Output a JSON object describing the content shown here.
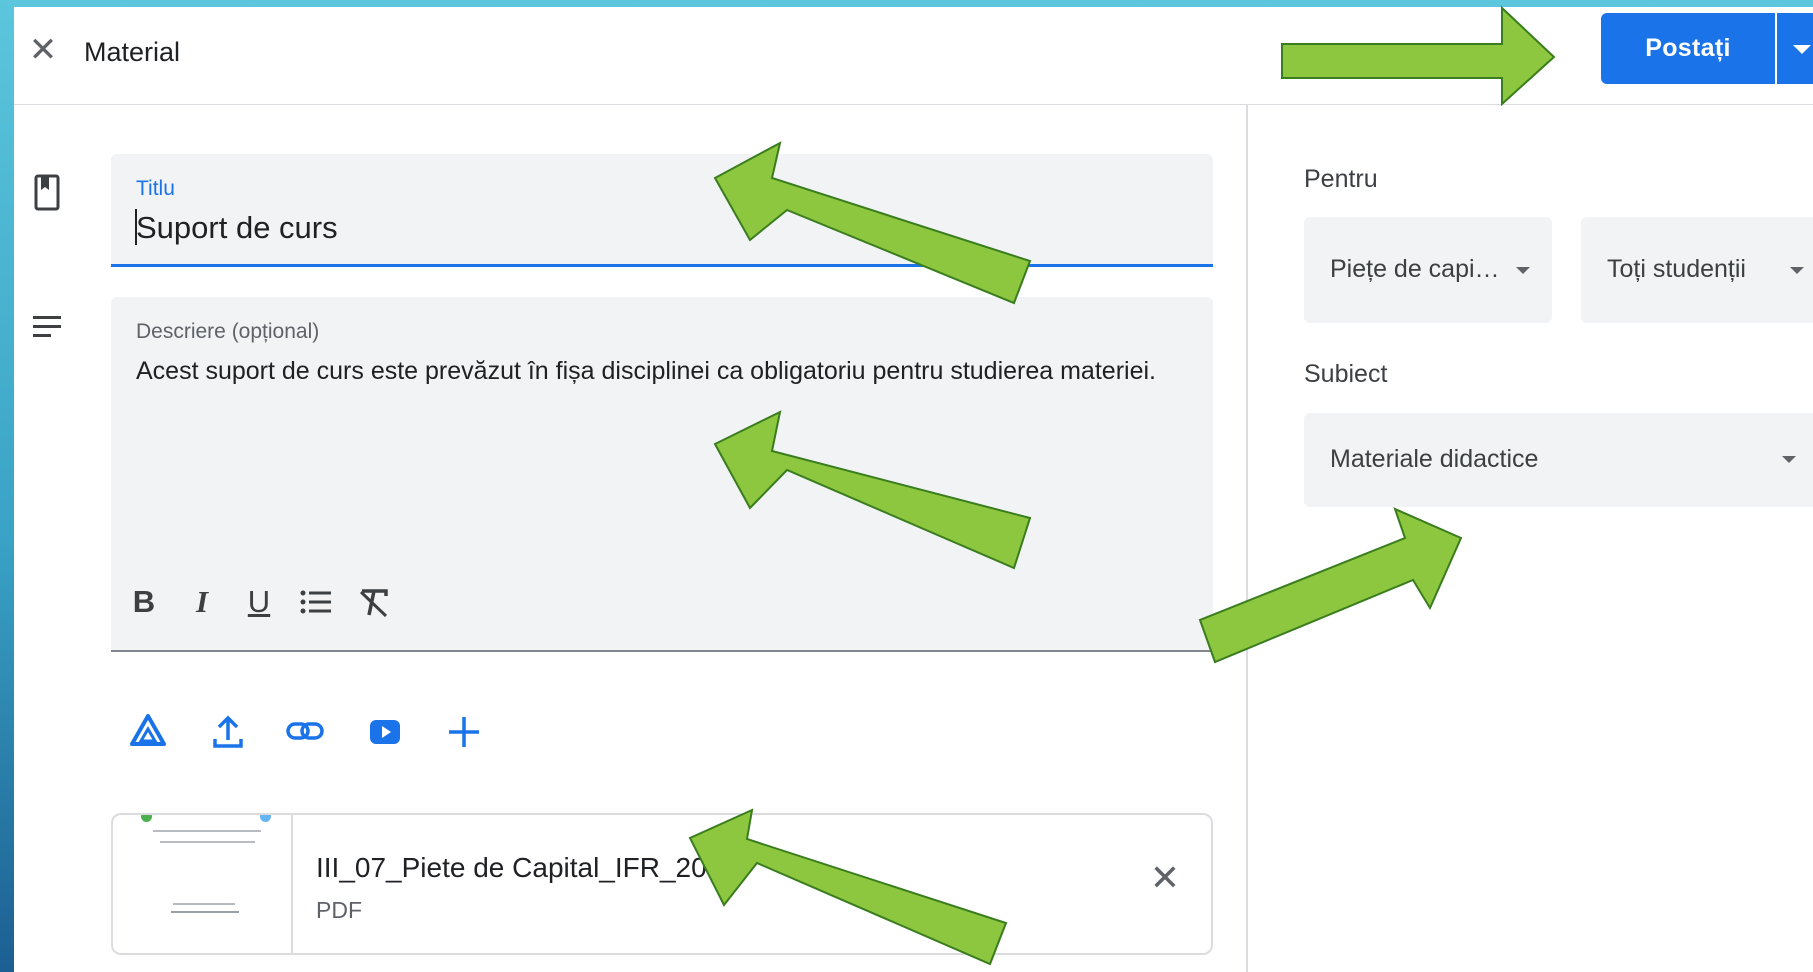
{
  "header": {
    "title": "Material",
    "post_label": "Postați"
  },
  "form": {
    "title_label": "Titlu",
    "title_value": "Suport de curs",
    "description_label": "Descriere (opțional)",
    "description_value": "Acest suport de curs este prevăzut în fișa disciplinei ca obligatoriu pentru studierea materiei.",
    "format_buttons": [
      "B",
      "I",
      "U",
      "bulleted-list",
      "clear-formatting"
    ],
    "attach_buttons": [
      "google-drive",
      "upload",
      "link",
      "youtube",
      "add"
    ]
  },
  "attachment": {
    "name": "III_07_Piete de Capital_IFR_2019",
    "type": "PDF"
  },
  "sidebar": {
    "for_label": "Pentru",
    "class_select": "Piețe de capi…",
    "students_select": "Toți studenții",
    "topic_label": "Subiect",
    "topic_select": "Materiale didactice"
  },
  "colors": {
    "accent": "#1a73e8",
    "arrow": "#8dc63f",
    "field_bg": "#f1f3f4"
  }
}
